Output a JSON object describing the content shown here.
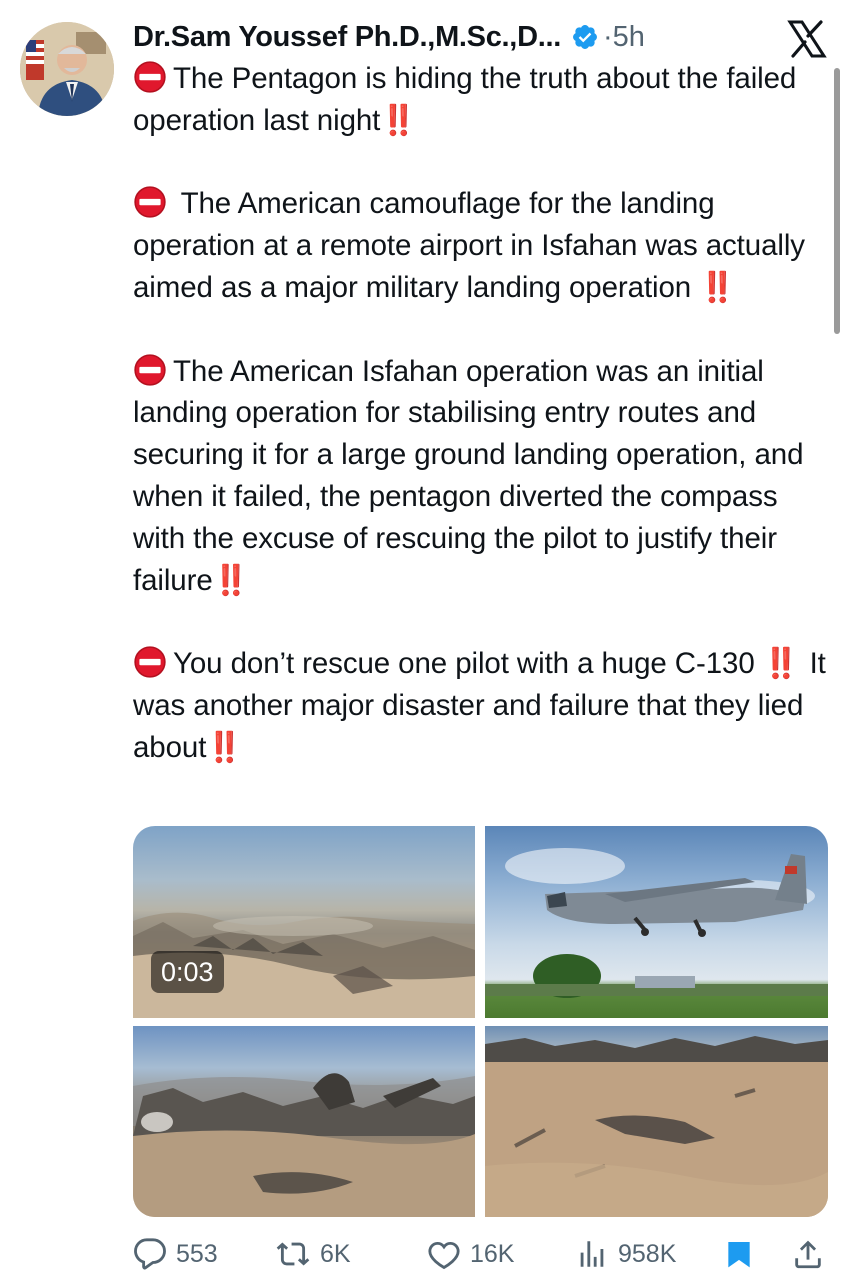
{
  "author": {
    "display_name": "Dr.Sam Youssef Ph.D.,M.Sc.,D...",
    "verified": true,
    "separator": "·",
    "timestamp": "5h"
  },
  "tweet": {
    "paragraphs": [
      {
        "icon": "no-entry-icon",
        "text": "The Pentagon is hiding the truth about the failed operation last night",
        "suffix": "‼️"
      },
      {
        "icon": "no-entry-icon",
        "text": " The American camouflage for the landing operation at a remote airport in Isfahan was actually aimed as a major military landing operation ",
        "suffix": "‼️"
      },
      {
        "icon": "no-entry-icon",
        "text": "The American Isfahan operation was an initial landing operation for stabilising entry routes and securing it for a large ground landing operation, and when it failed, the pentagon diverted the compass with the excuse of rescuing the pilot to justify their failure",
        "suffix": "‼️"
      },
      {
        "icon": "no-entry-icon",
        "text": "You don’t rescue one pilot with a huge C-130 ",
        "suffix": "‼️",
        "text2": " It was another major disaster and failure that they lied about",
        "suffix2": "‼️"
      }
    ]
  },
  "media": {
    "video_duration": "0:03"
  },
  "actions": {
    "replies": "553",
    "reposts": "6K",
    "likes": "16K",
    "views": "958K"
  },
  "colors": {
    "text": "#0f1419",
    "secondary": "#536471",
    "verified_blue": "#1d9bf0",
    "bookmark_blue": "#1d9bf0",
    "alert_red": "#e0182d"
  }
}
